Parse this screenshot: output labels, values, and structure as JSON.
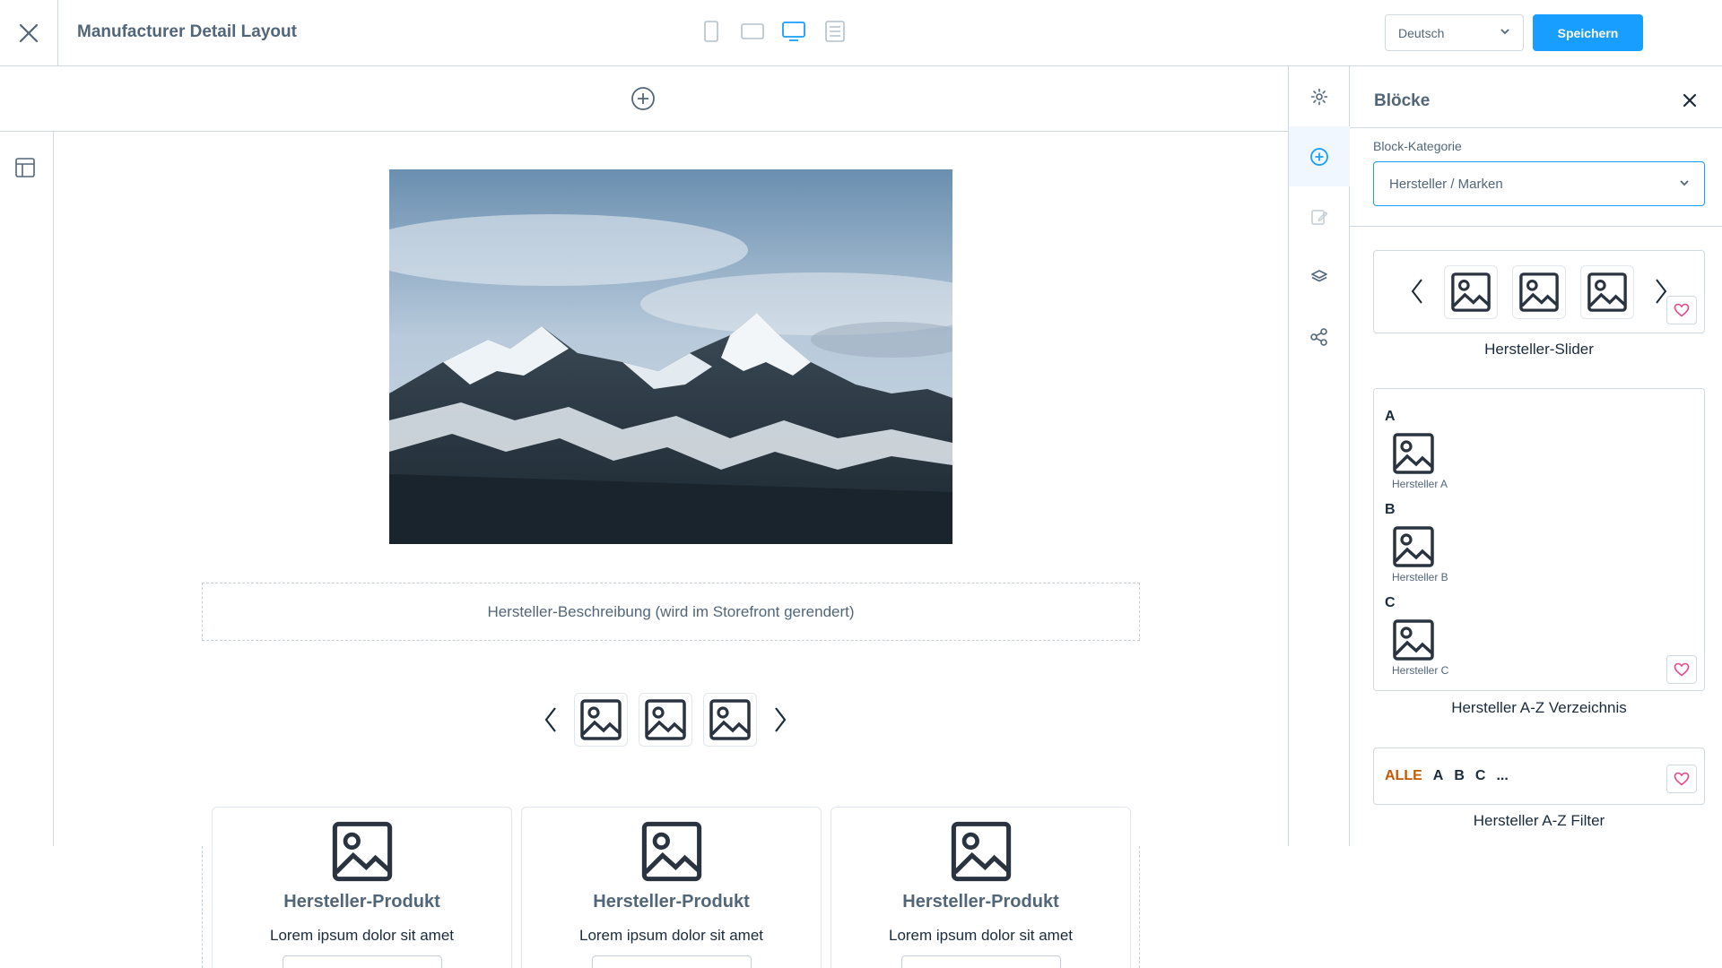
{
  "header": {
    "title": "Manufacturer Detail Layout",
    "language": "Deutsch",
    "save_label": "Speichern"
  },
  "canvas": {
    "description_placeholder": "Hersteller-Beschreibung (wird im Storefront gerendert)",
    "products": [
      {
        "name": "Hersteller-Produkt",
        "description": "Lorem ipsum dolor sit amet"
      },
      {
        "name": "Hersteller-Produkt",
        "description": "Lorem ipsum dolor sit amet"
      },
      {
        "name": "Hersteller-Produkt",
        "description": "Lorem ipsum dolor sit amet"
      }
    ]
  },
  "panel": {
    "title": "Blöcke",
    "category_label": "Block-Kategorie",
    "category_value": "Hersteller / Marken",
    "blocks": [
      {
        "label": "Hersteller-Slider"
      },
      {
        "label": "Hersteller A-Z Verzeichnis",
        "letters": [
          "A",
          "B",
          "C"
        ],
        "items": [
          "Hersteller A",
          "Hersteller B",
          "Hersteller C"
        ]
      },
      {
        "label": "Hersteller A-Z Filter",
        "filters": [
          "ALLE",
          "A",
          "B",
          "C",
          "..."
        ]
      }
    ]
  },
  "colors": {
    "accent": "#189eff",
    "text": "#52667a",
    "border": "#d1d9e0",
    "heart": "#e8458b",
    "alle": "#c25b00"
  }
}
